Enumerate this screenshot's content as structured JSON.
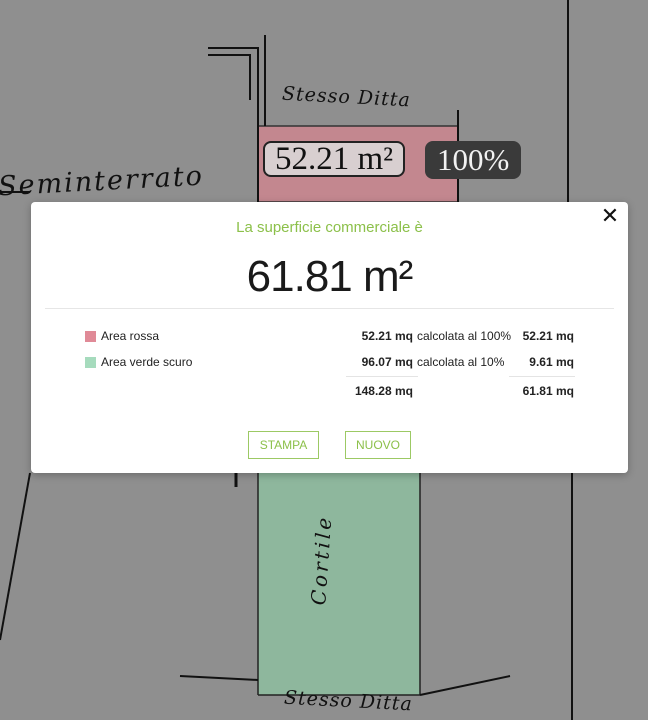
{
  "plan": {
    "label_top": "Stesso Ditta",
    "label_semi": "Seminterrato",
    "label_bottom": "Stesso Ditta",
    "label_cortile": "Cortile",
    "area_label": "52.21 m²",
    "percent_label": "100%",
    "colors": {
      "red_area": "#d4848f",
      "green_area": "#8dc0a0"
    }
  },
  "modal": {
    "title": "La superficie commerciale è",
    "total": "61.81 m²",
    "close_icon": "close-icon",
    "rows": [
      {
        "name": "Area rossa",
        "measure": "52.21 mq",
        "calc": "calcolata al 100%",
        "result": "52.21 mq",
        "color": "#e08a97"
      },
      {
        "name": "Area verde scuro",
        "measure": "96.07 mq",
        "calc": "calcolata al 10%",
        "result": "9.61 mq",
        "color": "#a6dbbd"
      }
    ],
    "sum_measure": "148.28 mq",
    "sum_result": "61.81 mq",
    "buttons": {
      "print": "STAMPA",
      "new": "NUOVO"
    },
    "accent_color": "#8cc04a"
  }
}
